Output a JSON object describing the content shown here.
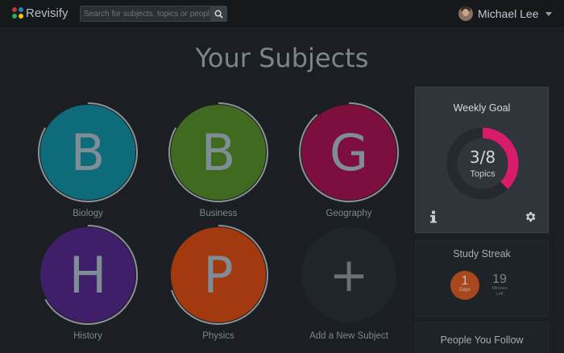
{
  "app": {
    "name": "Revisify"
  },
  "search": {
    "placeholder": "Search for subjects, topics or people"
  },
  "user": {
    "name": "Michael Lee"
  },
  "page": {
    "title": "Your Subjects"
  },
  "subjects": [
    {
      "letter": "B",
      "name": "Biology",
      "color": "#0e6b7a",
      "progress_deg": 300
    },
    {
      "letter": "B",
      "name": "Business",
      "color": "#3f6a1f",
      "progress_deg": 300
    },
    {
      "letter": "G",
      "name": "Geography",
      "color": "#7d0f3f",
      "progress_deg": 320
    },
    {
      "letter": "H",
      "name": "History",
      "color": "#3f1f69",
      "progress_deg": 240
    },
    {
      "letter": "P",
      "name": "Physics",
      "color": "#a3390f",
      "progress_deg": 250
    }
  ],
  "add_subject": {
    "symbol": "+",
    "label": "Add a New Subject"
  },
  "weekly_goal": {
    "title": "Weekly Goal",
    "completed": 3,
    "target": 8,
    "value_text": "3/8",
    "unit": "Topics",
    "accent": "#d81b6b"
  },
  "study_streak": {
    "title": "Study Streak",
    "days": "1",
    "days_label": "Days",
    "minutes": "19",
    "minutes_label_1": "Minutes",
    "minutes_label_2": "Left"
  },
  "people_follow": {
    "title": "People You Follow"
  }
}
